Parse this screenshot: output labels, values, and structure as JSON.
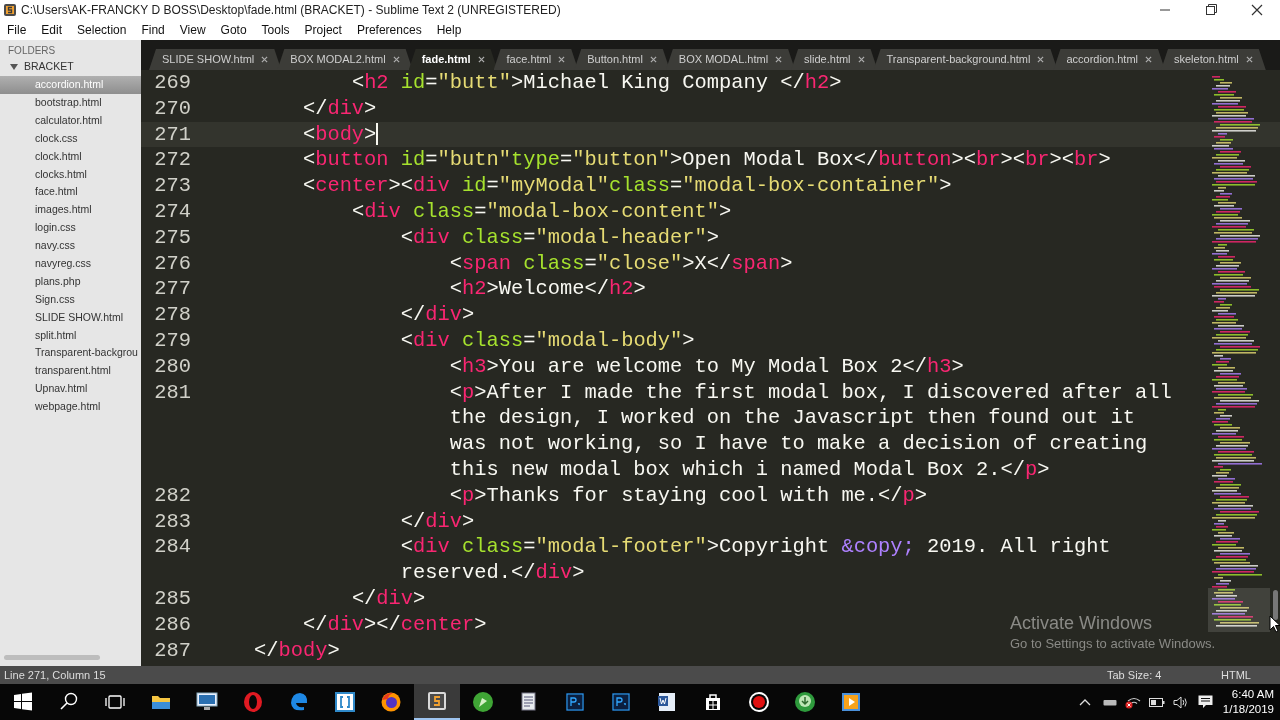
{
  "window": {
    "title": "C:\\Users\\AK-FRANCKY D BOSS\\Desktop\\fade.html (BRACKET) - Sublime Text 2 (UNREGISTERED)"
  },
  "menu": [
    "File",
    "Edit",
    "Selection",
    "Find",
    "View",
    "Goto",
    "Tools",
    "Project",
    "Preferences",
    "Help"
  ],
  "sidebar": {
    "header": "FOLDERS",
    "folder": {
      "name": "BRACKET",
      "expanded": true,
      "files": [
        {
          "name": "accordion.html",
          "selected": true
        },
        {
          "name": "bootstrap.html",
          "selected": false
        },
        {
          "name": "calculator.html",
          "selected": false
        },
        {
          "name": "clock.css",
          "selected": false
        },
        {
          "name": "clock.html",
          "selected": false
        },
        {
          "name": "clocks.html",
          "selected": false
        },
        {
          "name": "face.html",
          "selected": false
        },
        {
          "name": "images.html",
          "selected": false
        },
        {
          "name": "login.css",
          "selected": false
        },
        {
          "name": "navy.css",
          "selected": false
        },
        {
          "name": "navyreg.css",
          "selected": false
        },
        {
          "name": "plans.php",
          "selected": false
        },
        {
          "name": "Sign.css",
          "selected": false
        },
        {
          "name": "SLIDE SHOW.html",
          "selected": false
        },
        {
          "name": "split.html",
          "selected": false
        },
        {
          "name": "Transparent-backgrou",
          "selected": false
        },
        {
          "name": "transparent.html",
          "selected": false
        },
        {
          "name": "Upnav.html",
          "selected": false
        },
        {
          "name": "webpage.html",
          "selected": false
        }
      ]
    }
  },
  "tabs": [
    {
      "label": "SLIDE SHOW.html",
      "selected": false
    },
    {
      "label": "BOX MODAL2.html",
      "selected": false
    },
    {
      "label": "fade.html",
      "selected": true
    },
    {
      "label": "face.html",
      "selected": false
    },
    {
      "label": "Button.html",
      "selected": false
    },
    {
      "label": "BOX MODAL.html",
      "selected": false
    },
    {
      "label": "slide.html",
      "selected": false
    },
    {
      "label": "Transparent-background.html",
      "selected": false
    },
    {
      "label": "accordion.html",
      "selected": false
    },
    {
      "label": "skeleton.html",
      "selected": false
    }
  ],
  "editor": {
    "lines": [
      {
        "number": "269",
        "current": false,
        "rows": [
          "            <h2 id=\"butt\">Michael King Company </h2>"
        ]
      },
      {
        "number": "270",
        "current": false,
        "rows": [
          "        </div>"
        ]
      },
      {
        "number": "271",
        "current": true,
        "rows": [
          "        <body>"
        ]
      },
      {
        "number": "272",
        "current": false,
        "rows": [
          "        <button id=\"butn\"type=\"button\">Open Modal Box</button><br><br><br>"
        ]
      },
      {
        "number": "273",
        "current": false,
        "rows": [
          "        <center><div id=\"myModal\"class=\"modal-box-container\">"
        ]
      },
      {
        "number": "274",
        "current": false,
        "rows": [
          "            <div class=\"modal-box-content\">"
        ]
      },
      {
        "number": "275",
        "current": false,
        "rows": [
          "                <div class=\"modal-header\">"
        ]
      },
      {
        "number": "276",
        "current": false,
        "rows": [
          "                    <span class=\"close\">X</span>"
        ]
      },
      {
        "number": "277",
        "current": false,
        "rows": [
          "                    <h2>Welcome</h2>"
        ]
      },
      {
        "number": "278",
        "current": false,
        "rows": [
          "                </div>"
        ]
      },
      {
        "number": "279",
        "current": false,
        "rows": [
          "                <div class=\"modal-body\">"
        ]
      },
      {
        "number": "280",
        "current": false,
        "rows": [
          "                    <h3>You are welcome to My Modal Box 2</h3>"
        ]
      },
      {
        "number": "281",
        "current": false,
        "rows": [
          "                    <p>After I made the first modal box, I discovered after all",
          "the design, I worked on the Javascript then found out it",
          "was not working, so I have to make a decision of creating",
          "this new modal box which i named Modal Box 2.</p>"
        ]
      },
      {
        "number": "282",
        "current": false,
        "rows": [
          "                    <p>Thanks for staying cool with me.</p>"
        ]
      },
      {
        "number": "283",
        "current": false,
        "rows": [
          "                </div>"
        ]
      },
      {
        "number": "284",
        "current": false,
        "rows": [
          "                <div class=\"modal-footer\">Copyright &copy; 2019. All right",
          "reserved.</div>"
        ]
      },
      {
        "number": "285",
        "current": false,
        "rows": [
          "            </div>"
        ]
      },
      {
        "number": "286",
        "current": false,
        "rows": [
          "        </div></center>"
        ]
      },
      {
        "number": "287",
        "current": false,
        "rows": [
          "    </body>"
        ]
      }
    ]
  },
  "activation": {
    "title": "Activate Windows",
    "message": "Go to Settings to activate Windows."
  },
  "status_bar": {
    "position": "Line 271, Column 15",
    "tab_size": "Tab Size: 4",
    "syntax": "HTML"
  },
  "taskbar": {
    "apps": [
      {
        "kind": "explorer",
        "active": false
      },
      {
        "kind": "monitor",
        "active": false
      },
      {
        "kind": "opera",
        "active": false
      },
      {
        "kind": "edge",
        "active": false
      },
      {
        "kind": "brackets",
        "active": false
      },
      {
        "kind": "firefox",
        "active": false
      },
      {
        "kind": "sublime",
        "active": true
      },
      {
        "kind": "corel",
        "active": false
      },
      {
        "kind": "document",
        "active": false
      },
      {
        "kind": "photoshop",
        "active": false
      },
      {
        "kind": "photoshop",
        "active": false
      },
      {
        "kind": "word",
        "active": false
      },
      {
        "kind": "store",
        "active": false
      },
      {
        "kind": "record",
        "active": false
      },
      {
        "kind": "download",
        "active": false
      },
      {
        "kind": "player",
        "active": false
      }
    ],
    "time": "6:40 AM",
    "date": "1/18/2019"
  }
}
